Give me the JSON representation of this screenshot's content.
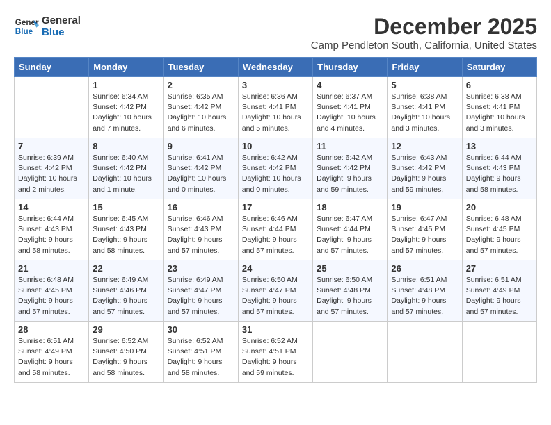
{
  "header": {
    "logo_line1": "General",
    "logo_line2": "Blue",
    "month": "December 2025",
    "location": "Camp Pendleton South, California, United States"
  },
  "weekdays": [
    "Sunday",
    "Monday",
    "Tuesday",
    "Wednesday",
    "Thursday",
    "Friday",
    "Saturday"
  ],
  "weeks": [
    [
      {
        "day": "",
        "sunrise": "",
        "sunset": "",
        "daylight": ""
      },
      {
        "day": "1",
        "sunrise": "Sunrise: 6:34 AM",
        "sunset": "Sunset: 4:42 PM",
        "daylight": "Daylight: 10 hours and 7 minutes."
      },
      {
        "day": "2",
        "sunrise": "Sunrise: 6:35 AM",
        "sunset": "Sunset: 4:42 PM",
        "daylight": "Daylight: 10 hours and 6 minutes."
      },
      {
        "day": "3",
        "sunrise": "Sunrise: 6:36 AM",
        "sunset": "Sunset: 4:41 PM",
        "daylight": "Daylight: 10 hours and 5 minutes."
      },
      {
        "day": "4",
        "sunrise": "Sunrise: 6:37 AM",
        "sunset": "Sunset: 4:41 PM",
        "daylight": "Daylight: 10 hours and 4 minutes."
      },
      {
        "day": "5",
        "sunrise": "Sunrise: 6:38 AM",
        "sunset": "Sunset: 4:41 PM",
        "daylight": "Daylight: 10 hours and 3 minutes."
      },
      {
        "day": "6",
        "sunrise": "Sunrise: 6:38 AM",
        "sunset": "Sunset: 4:41 PM",
        "daylight": "Daylight: 10 hours and 3 minutes."
      }
    ],
    [
      {
        "day": "7",
        "sunrise": "Sunrise: 6:39 AM",
        "sunset": "Sunset: 4:42 PM",
        "daylight": "Daylight: 10 hours and 2 minutes."
      },
      {
        "day": "8",
        "sunrise": "Sunrise: 6:40 AM",
        "sunset": "Sunset: 4:42 PM",
        "daylight": "Daylight: 10 hours and 1 minute."
      },
      {
        "day": "9",
        "sunrise": "Sunrise: 6:41 AM",
        "sunset": "Sunset: 4:42 PM",
        "daylight": "Daylight: 10 hours and 0 minutes."
      },
      {
        "day": "10",
        "sunrise": "Sunrise: 6:42 AM",
        "sunset": "Sunset: 4:42 PM",
        "daylight": "Daylight: 10 hours and 0 minutes."
      },
      {
        "day": "11",
        "sunrise": "Sunrise: 6:42 AM",
        "sunset": "Sunset: 4:42 PM",
        "daylight": "Daylight: 9 hours and 59 minutes."
      },
      {
        "day": "12",
        "sunrise": "Sunrise: 6:43 AM",
        "sunset": "Sunset: 4:42 PM",
        "daylight": "Daylight: 9 hours and 59 minutes."
      },
      {
        "day": "13",
        "sunrise": "Sunrise: 6:44 AM",
        "sunset": "Sunset: 4:43 PM",
        "daylight": "Daylight: 9 hours and 58 minutes."
      }
    ],
    [
      {
        "day": "14",
        "sunrise": "Sunrise: 6:44 AM",
        "sunset": "Sunset: 4:43 PM",
        "daylight": "Daylight: 9 hours and 58 minutes."
      },
      {
        "day": "15",
        "sunrise": "Sunrise: 6:45 AM",
        "sunset": "Sunset: 4:43 PM",
        "daylight": "Daylight: 9 hours and 58 minutes."
      },
      {
        "day": "16",
        "sunrise": "Sunrise: 6:46 AM",
        "sunset": "Sunset: 4:43 PM",
        "daylight": "Daylight: 9 hours and 57 minutes."
      },
      {
        "day": "17",
        "sunrise": "Sunrise: 6:46 AM",
        "sunset": "Sunset: 4:44 PM",
        "daylight": "Daylight: 9 hours and 57 minutes."
      },
      {
        "day": "18",
        "sunrise": "Sunrise: 6:47 AM",
        "sunset": "Sunset: 4:44 PM",
        "daylight": "Daylight: 9 hours and 57 minutes."
      },
      {
        "day": "19",
        "sunrise": "Sunrise: 6:47 AM",
        "sunset": "Sunset: 4:45 PM",
        "daylight": "Daylight: 9 hours and 57 minutes."
      },
      {
        "day": "20",
        "sunrise": "Sunrise: 6:48 AM",
        "sunset": "Sunset: 4:45 PM",
        "daylight": "Daylight: 9 hours and 57 minutes."
      }
    ],
    [
      {
        "day": "21",
        "sunrise": "Sunrise: 6:48 AM",
        "sunset": "Sunset: 4:45 PM",
        "daylight": "Daylight: 9 hours and 57 minutes."
      },
      {
        "day": "22",
        "sunrise": "Sunrise: 6:49 AM",
        "sunset": "Sunset: 4:46 PM",
        "daylight": "Daylight: 9 hours and 57 minutes."
      },
      {
        "day": "23",
        "sunrise": "Sunrise: 6:49 AM",
        "sunset": "Sunset: 4:47 PM",
        "daylight": "Daylight: 9 hours and 57 minutes."
      },
      {
        "day": "24",
        "sunrise": "Sunrise: 6:50 AM",
        "sunset": "Sunset: 4:47 PM",
        "daylight": "Daylight: 9 hours and 57 minutes."
      },
      {
        "day": "25",
        "sunrise": "Sunrise: 6:50 AM",
        "sunset": "Sunset: 4:48 PM",
        "daylight": "Daylight: 9 hours and 57 minutes."
      },
      {
        "day": "26",
        "sunrise": "Sunrise: 6:51 AM",
        "sunset": "Sunset: 4:48 PM",
        "daylight": "Daylight: 9 hours and 57 minutes."
      },
      {
        "day": "27",
        "sunrise": "Sunrise: 6:51 AM",
        "sunset": "Sunset: 4:49 PM",
        "daylight": "Daylight: 9 hours and 57 minutes."
      }
    ],
    [
      {
        "day": "28",
        "sunrise": "Sunrise: 6:51 AM",
        "sunset": "Sunset: 4:49 PM",
        "daylight": "Daylight: 9 hours and 58 minutes."
      },
      {
        "day": "29",
        "sunrise": "Sunrise: 6:52 AM",
        "sunset": "Sunset: 4:50 PM",
        "daylight": "Daylight: 9 hours and 58 minutes."
      },
      {
        "day": "30",
        "sunrise": "Sunrise: 6:52 AM",
        "sunset": "Sunset: 4:51 PM",
        "daylight": "Daylight: 9 hours and 58 minutes."
      },
      {
        "day": "31",
        "sunrise": "Sunrise: 6:52 AM",
        "sunset": "Sunset: 4:51 PM",
        "daylight": "Daylight: 9 hours and 59 minutes."
      },
      {
        "day": "",
        "sunrise": "",
        "sunset": "",
        "daylight": ""
      },
      {
        "day": "",
        "sunrise": "",
        "sunset": "",
        "daylight": ""
      },
      {
        "day": "",
        "sunrise": "",
        "sunset": "",
        "daylight": ""
      }
    ]
  ]
}
